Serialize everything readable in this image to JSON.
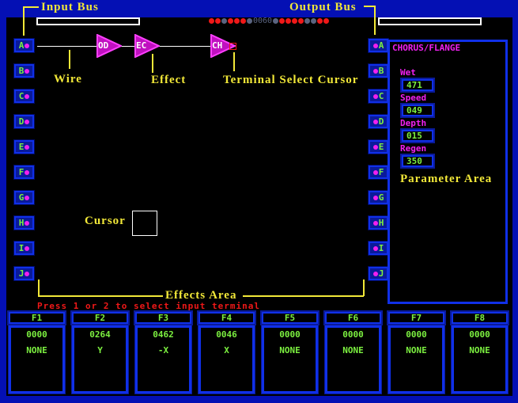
{
  "labels": {
    "input_bus": "Input Bus",
    "output_bus": "Output Bus",
    "wire": "Wire",
    "effect": "Effect",
    "terminal_cursor": "Terminal Select Cursor",
    "cursor": "Cursor",
    "parameter_area": "Parameter Area",
    "effects_area": "Effects Area"
  },
  "counter": "0060",
  "leds_left": [
    "red",
    "red",
    "gray",
    "red",
    "red",
    "red",
    "gray"
  ],
  "leds_right": [
    "gray",
    "red",
    "red",
    "red",
    "red",
    "gray",
    "gray",
    "red",
    "red"
  ],
  "input_terminals": [
    "A",
    "B",
    "C",
    "D",
    "E",
    "F",
    "G",
    "H",
    "I",
    "J"
  ],
  "output_terminals": [
    "A",
    "B",
    "C",
    "D",
    "E",
    "F",
    "G",
    "H",
    "I",
    "J"
  ],
  "effects": [
    {
      "label": "OD"
    },
    {
      "label": "EC"
    },
    {
      "label": "CH"
    }
  ],
  "parameters": {
    "title": "CHORUS/FLANGE",
    "items": [
      {
        "name": "Wet",
        "value": "471"
      },
      {
        "name": "Speed",
        "value": "049"
      },
      {
        "name": "Depth",
        "value": "015"
      },
      {
        "name": "Regen",
        "value": "350"
      }
    ]
  },
  "status_message": "Press 1 or 2 to select input terminal",
  "function_keys": [
    {
      "key": "F1",
      "value": "0000",
      "mode": "NONE"
    },
    {
      "key": "F2",
      "value": "0264",
      "mode": "Y"
    },
    {
      "key": "F3",
      "value": "0462",
      "mode": "-X"
    },
    {
      "key": "F4",
      "value": "0046",
      "mode": "X"
    },
    {
      "key": "F5",
      "value": "0000",
      "mode": "NONE"
    },
    {
      "key": "F6",
      "value": "0000",
      "mode": "NONE"
    },
    {
      "key": "F7",
      "value": "0000",
      "mode": "NONE"
    },
    {
      "key": "F8",
      "value": "0000",
      "mode": "NONE"
    }
  ],
  "colors": {
    "background": "#0410b4",
    "accent_green": "#7cf040",
    "magenta": "#f020f0",
    "annotation": "#f2e838",
    "led_red": "#f01818",
    "led_gray": "#5a6480"
  }
}
